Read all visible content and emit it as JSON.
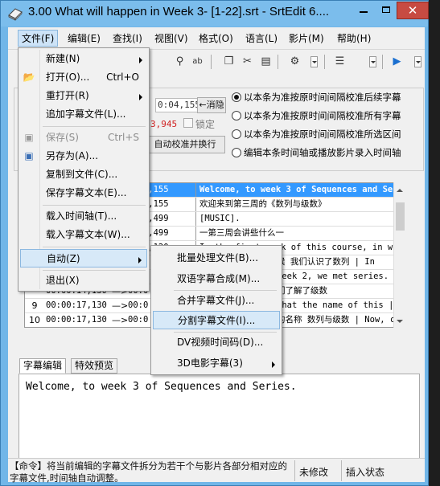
{
  "window": {
    "title": "3.00 What will happen in Week 3- [1-22].srt - SrtEdit 6...."
  },
  "menubar": [
    {
      "label": "文件(F)"
    },
    {
      "label": "编辑(E)"
    },
    {
      "label": "查找(I)"
    },
    {
      "label": "视图(V)"
    },
    {
      "label": "格式(O)"
    },
    {
      "label": "语言(L)"
    },
    {
      "label": "影片(M)"
    },
    {
      "label": "帮助(H)"
    }
  ],
  "timing_panel": {
    "start_time": "0:04,155",
    "cancel_label": "←消隐",
    "duration": "3,945",
    "lock_label": "锁定",
    "auto_label": "自动校准并换行",
    "radio_options": [
      {
        "label": "以本条为准按原时间间隔校准后续字幕",
        "selected": true
      },
      {
        "label": "以本条为准按原时间间隔校准所有字幕",
        "selected": false
      },
      {
        "label": "以本条为准按原时间间隔校准所选区间",
        "selected": false
      },
      {
        "label": "编辑本条时间轴或播放影片录入时间轴",
        "selected": false
      }
    ]
  },
  "subtitle_list": {
    "rows": [
      {
        "num": "",
        "start": "",
        "arrow": "",
        "end": "0:04,155",
        "text": "Welcome, to week 3 of Sequences and Ser",
        "selected": true
      },
      {
        "num": "",
        "start": "",
        "arrow": "",
        "end": "0:04,155",
        "text": "欢迎来到第三周的《数列与级数》",
        "selected": false
      },
      {
        "num": "",
        "start": "",
        "arrow": "",
        "end": "0:10,499",
        "text": "[MUSIC].",
        "selected": false
      },
      {
        "num": "",
        "start": "",
        "arrow": "",
        "end": "0:10,499",
        "text": "一第三周会讲些什么一",
        "selected": false
      },
      {
        "num": "",
        "start": "",
        "arrow": "",
        "end": "0:14,120",
        "text": "In the first week of this course, in week |",
        "selected": false
      },
      {
        "num": "",
        "start": "",
        "arrow": "",
        "end": "",
        "text": "候 我们认识了数列 | In",
        "selected": false
      },
      {
        "num": "",
        "start": "",
        "arrow": "",
        "end": "",
        "text": "week 2, we met series.",
        "selected": false
      },
      {
        "num": "",
        "start": "00:00:14,130",
        "arrow": "—>",
        "end": "00:0",
        "text": "们了解了级数",
        "selected": false
      },
      {
        "num": "9",
        "start": "00:00:17,130",
        "arrow": "—>",
        "end": "00:0",
        "text": "what the name of this | co",
        "selected": false
      },
      {
        "num": "10",
        "start": "00:00:17,130",
        "arrow": "—>",
        "end": "00:0",
        "text": "的名称 数列与级数 | Now, c",
        "selected": false
      }
    ]
  },
  "editor": {
    "tabs": [
      {
        "label": "字幕编辑"
      },
      {
        "label": "特效预览"
      }
    ],
    "text": "Welcome, to week 3 of Sequences and Series."
  },
  "statusbar": {
    "hint": "【命令】将当前编辑的字幕文件拆分为若干个与影片各部分相对应的字幕文件,时间轴自动调整。",
    "modified": "未修改",
    "insert_mode": "插入状态"
  },
  "file_menu": {
    "items": [
      {
        "label": "新建(N)",
        "shortcut": "",
        "submenu": true,
        "disabled": false,
        "icon": ""
      },
      {
        "label": "打开(O)...",
        "shortcut": "Ctrl+O",
        "submenu": false,
        "disabled": false,
        "icon": "open-folder-icon"
      },
      {
        "label": "重打开(R)",
        "shortcut": "",
        "submenu": true,
        "disabled": false,
        "icon": ""
      },
      {
        "label": "追加字幕文件(L)...",
        "shortcut": "",
        "submenu": false,
        "disabled": false,
        "icon": ""
      },
      {
        "label": "保存(S)",
        "shortcut": "Ctrl+S",
        "submenu": false,
        "disabled": true,
        "icon": "save-icon"
      },
      {
        "label": "另存为(A)...",
        "shortcut": "",
        "submenu": false,
        "disabled": false,
        "icon": "save-as-icon"
      },
      {
        "label": "复制到文件(C)...",
        "shortcut": "",
        "submenu": false,
        "disabled": false,
        "icon": ""
      },
      {
        "label": "保存字幕文本(E)...",
        "shortcut": "",
        "submenu": false,
        "disabled": false,
        "icon": ""
      },
      {
        "label": "载入时间轴(T)...",
        "shortcut": "",
        "submenu": false,
        "disabled": false,
        "icon": ""
      },
      {
        "label": "载入字幕文本(W)...",
        "shortcut": "",
        "submenu": false,
        "disabled": false,
        "icon": ""
      },
      {
        "label": "自动(Z)",
        "shortcut": "",
        "submenu": true,
        "disabled": false,
        "icon": ""
      },
      {
        "label": "退出(X)",
        "shortcut": "",
        "submenu": false,
        "disabled": false,
        "icon": ""
      }
    ]
  },
  "auto_submenu": {
    "items": [
      {
        "label": "批量处理文件(B)...",
        "submenu": false
      },
      {
        "label": "双语字幕合成(M)...",
        "submenu": false
      },
      {
        "label": "合并字幕文件(J)...",
        "submenu": false
      },
      {
        "label": "分割字幕文件(I)...",
        "submenu": false
      },
      {
        "label": "DV视频时间码(D)...",
        "submenu": false
      },
      {
        "label": "3D电影字幕(3)",
        "submenu": true
      }
    ]
  }
}
